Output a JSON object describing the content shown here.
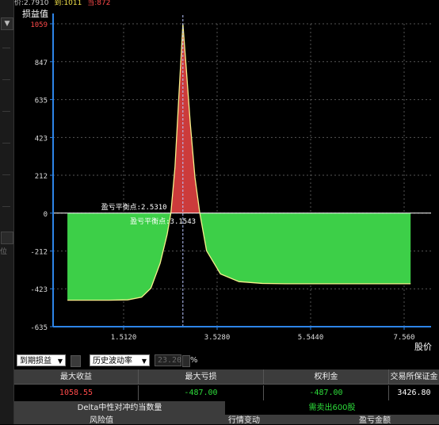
{
  "topbar": {
    "price": "价:2.7910",
    "expiry": "到:1011",
    "current": "当:872"
  },
  "chart_data": {
    "type": "line",
    "ylabel": "损益值",
    "xlabel": "股价",
    "ylim": [
      -635,
      1059
    ],
    "y_ticks": [
      "1059",
      "847",
      "635",
      "423",
      "212",
      "0",
      "-212",
      "-423",
      "-635"
    ],
    "x_ticks": [
      "1.5120",
      "3.5280",
      "5.5440",
      "7.560"
    ],
    "current_price": 2.79,
    "breakeven_labels": [
      "盈亏平衡点:2.5310",
      "盈亏平衡点:3.1543"
    ],
    "breakevens": [
      2.531,
      3.1543
    ],
    "max_profit": 1058.55,
    "max_loss_left": -487.0,
    "max_loss_right": -395.0,
    "series": [
      {
        "x": [
          0.3,
          1.2,
          1.6,
          1.9,
          2.1,
          2.3,
          2.45,
          2.531,
          2.62,
          2.7,
          2.79,
          2.86,
          2.95,
          3.05,
          3.1543,
          3.3,
          3.6,
          4.0,
          4.5,
          5.0,
          6.0,
          7.7
        ],
        "values": [
          -487,
          -487,
          -485,
          -470,
          -420,
          -280,
          -120,
          0,
          260,
          640,
          1058,
          820,
          500,
          200,
          0,
          -210,
          -340,
          -383,
          -393,
          -395,
          -395,
          -395
        ]
      }
    ],
    "colors": {
      "profit": "#cc3b3b",
      "loss": "#3dcf48",
      "curve": "#f5f08a",
      "axis": "#2d84e8",
      "grid": "#555555",
      "price_line": "#b9c6ff"
    }
  },
  "controls": {
    "mode_select": "到期损益",
    "vol_select": "历史波动率",
    "vol_value": "23.20",
    "percent": "%"
  },
  "table": {
    "headers": [
      "最大收益",
      "最大亏损",
      "权利金",
      "交易所保证金"
    ],
    "values": [
      "1058.55",
      "-487.00",
      "-487.00",
      "3426.80"
    ],
    "value_colors": [
      "#ff4a4a",
      "#2ddc3a",
      "#2ddc3a",
      "#ffffff"
    ],
    "delta_label": "Delta中性对冲约当数量",
    "delta_value": "需卖出600股",
    "bottom_headers": [
      "风险值",
      "行情变动",
      "盈亏金额"
    ]
  },
  "sidebar": {
    "down_arrow": "▼",
    "letter": "位"
  }
}
